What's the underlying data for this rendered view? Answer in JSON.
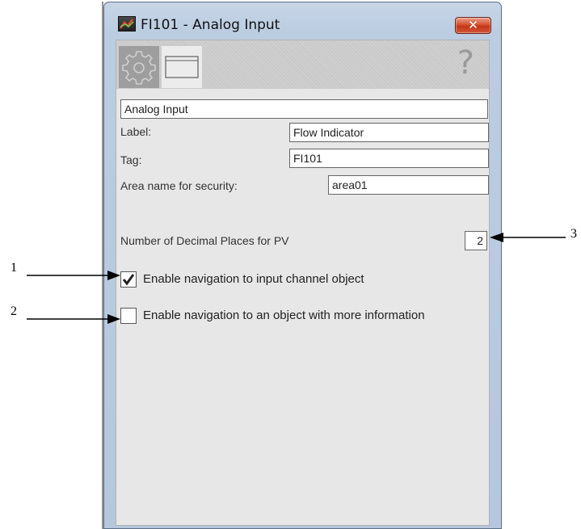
{
  "window": {
    "title": "FI101 - Analog Input",
    "close_symbol": "✕"
  },
  "toolbar": {
    "tabs": [
      {
        "name": "settings",
        "icon": "gear-icon",
        "selected": true
      },
      {
        "name": "faceplate",
        "icon": "window-icon",
        "selected": false
      }
    ],
    "help_symbol": "?"
  },
  "form": {
    "description_value": "Analog Input",
    "label_caption": "Label:",
    "label_value": "Flow Indicator",
    "tag_caption": "Tag:",
    "tag_value": "FI101",
    "area_caption": "Area name for security:",
    "area_value": "area01",
    "decimals_caption": "Number of Decimal Places for PV",
    "decimals_value": "2",
    "nav_input_label": "Enable navigation to input channel object",
    "nav_input_checked": true,
    "nav_more_label": "Enable navigation to an object with more information",
    "nav_more_checked": false
  },
  "callouts": {
    "one": "1",
    "two": "2",
    "three": "3"
  },
  "colors": {
    "frame": "#bccde2",
    "panel": "#e7e7e7",
    "close_red": "#d6512e"
  }
}
